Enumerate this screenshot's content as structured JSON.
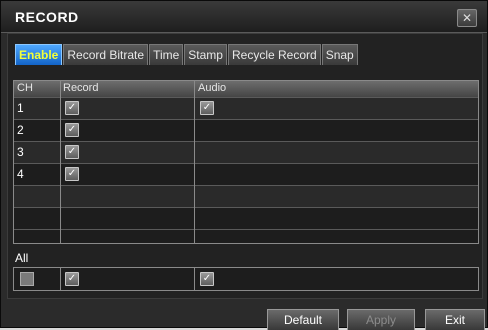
{
  "window": {
    "title": "RECORD",
    "close_icon": "close-icon"
  },
  "tabs": [
    {
      "label": "Enable",
      "active": true
    },
    {
      "label": "Record Bitrate",
      "active": false
    },
    {
      "label": "Time",
      "active": false
    },
    {
      "label": "Stamp",
      "active": false
    },
    {
      "label": "Recycle Record",
      "active": false
    },
    {
      "label": "Snap",
      "active": false
    }
  ],
  "table": {
    "headers": {
      "ch": "CH",
      "record": "Record",
      "audio": "Audio"
    },
    "rows": [
      {
        "ch": "1",
        "record": true,
        "audio": true
      },
      {
        "ch": "2",
        "record": true,
        "audio": false
      },
      {
        "ch": "3",
        "record": true,
        "audio": false
      },
      {
        "ch": "4",
        "record": true,
        "audio": false
      }
    ]
  },
  "all": {
    "label": "All",
    "record": true,
    "audio": true
  },
  "buttons": {
    "default": "Default",
    "apply": "Apply",
    "exit": "Exit"
  },
  "colors": {
    "active_tab": "#1a74d8",
    "active_tab_text": "#f2ff3a"
  }
}
